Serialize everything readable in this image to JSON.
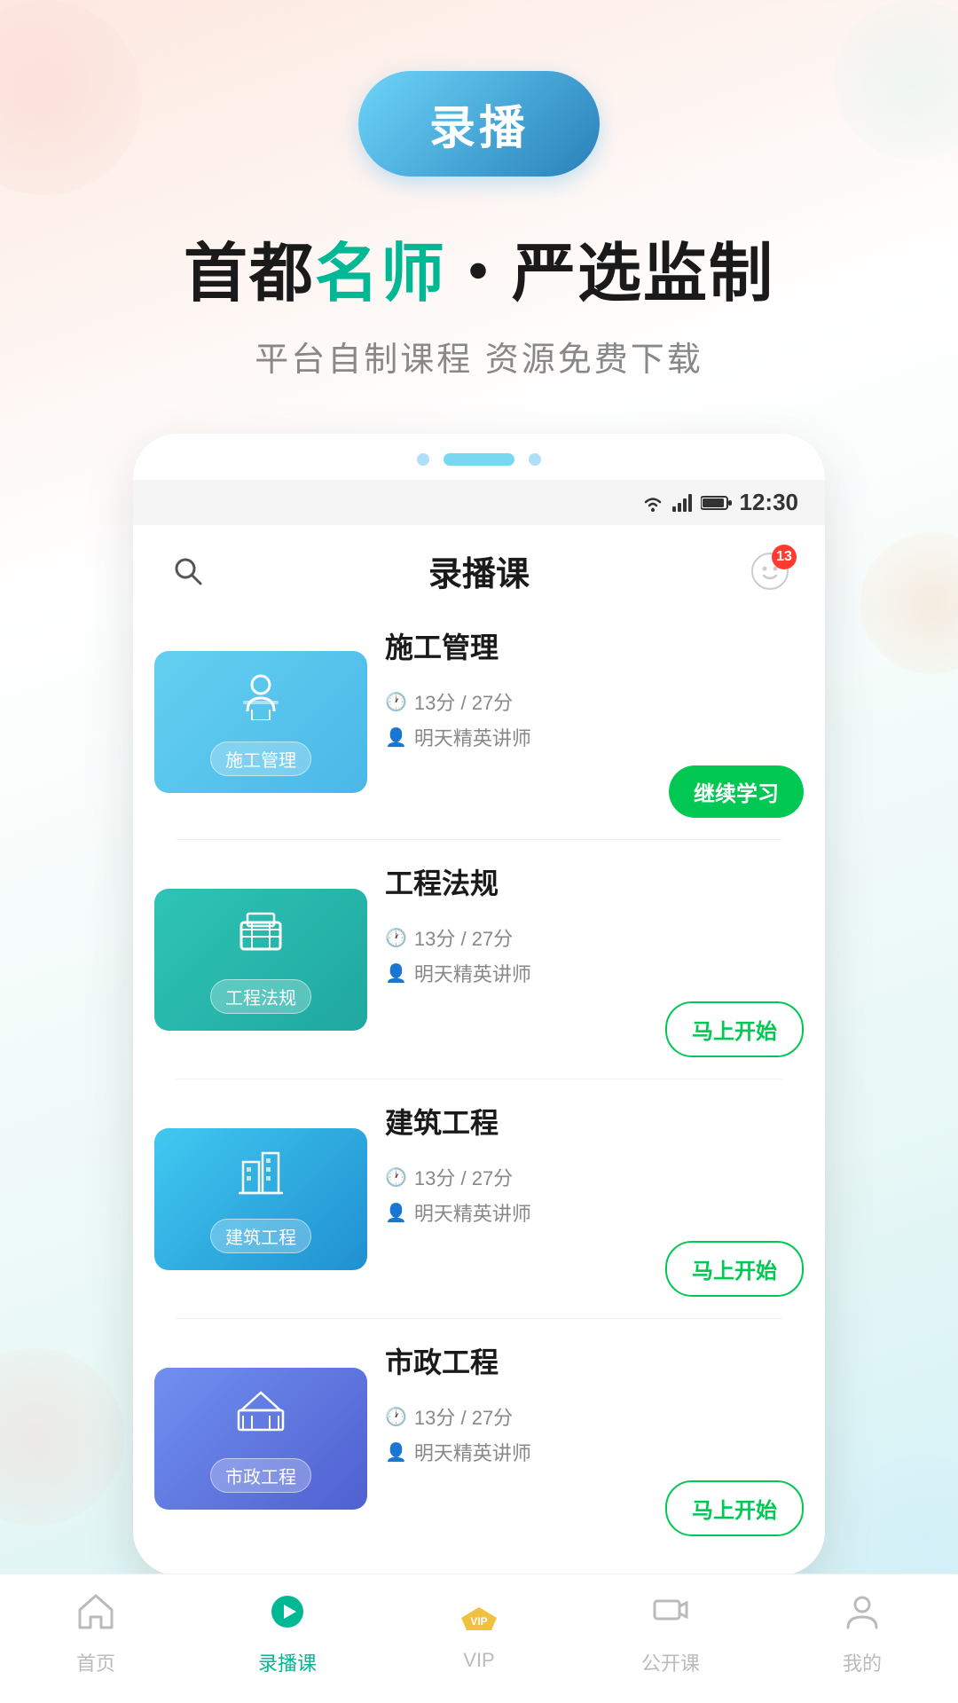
{
  "header": {
    "badge_label": "录播",
    "headline_part1": "首都",
    "headline_highlight": "名师",
    "headline_part2": "・严选监制",
    "subheadline": "平台自制课程 资源免费下载"
  },
  "phone": {
    "dots": [
      "small",
      "large",
      "small"
    ],
    "status_bar": {
      "time": "12:30"
    },
    "app_header": {
      "title": "录播课",
      "notification_count": "13"
    }
  },
  "courses": [
    {
      "id": "sggl",
      "name": "施工管理",
      "thumb_label": "施工管理",
      "thumb_class": "thumb-sggl",
      "thumb_icon": "👷",
      "duration": "13分 / 27分",
      "teacher": "明天精英讲师",
      "action": "continue",
      "action_label": "继续学习"
    },
    {
      "id": "gcfl",
      "name": "工程法规",
      "thumb_label": "工程法规",
      "thumb_class": "thumb-gcfl",
      "thumb_icon": "🚧",
      "duration": "13分 / 27分",
      "teacher": "明天精英讲师",
      "action": "start",
      "action_label": "马上开始"
    },
    {
      "id": "jzgc",
      "name": "建筑工程",
      "thumb_label": "建筑工程",
      "thumb_class": "thumb-jzgc",
      "thumb_icon": "🏢",
      "duration": "13分 / 27分",
      "teacher": "明天精英讲师",
      "action": "start",
      "action_label": "马上开始"
    },
    {
      "id": "szgc",
      "name": "市政工程",
      "thumb_label": "市政工程",
      "thumb_class": "thumb-szgc",
      "thumb_icon": "🏛️",
      "duration": "13分 / 27分",
      "teacher": "明天精英讲师",
      "action": "start",
      "action_label": "马上开始"
    }
  ],
  "bottom_nav": [
    {
      "id": "home",
      "label": "首页",
      "icon": "🏠",
      "active": false
    },
    {
      "id": "lubo",
      "label": "录播课",
      "icon": "⭐",
      "active": true
    },
    {
      "id": "vip",
      "label": "VIP",
      "icon": "👑",
      "active": false
    },
    {
      "id": "live",
      "label": "公开课",
      "icon": "📹",
      "active": false
    },
    {
      "id": "mine",
      "label": "我的",
      "icon": "👤",
      "active": false
    }
  ]
}
